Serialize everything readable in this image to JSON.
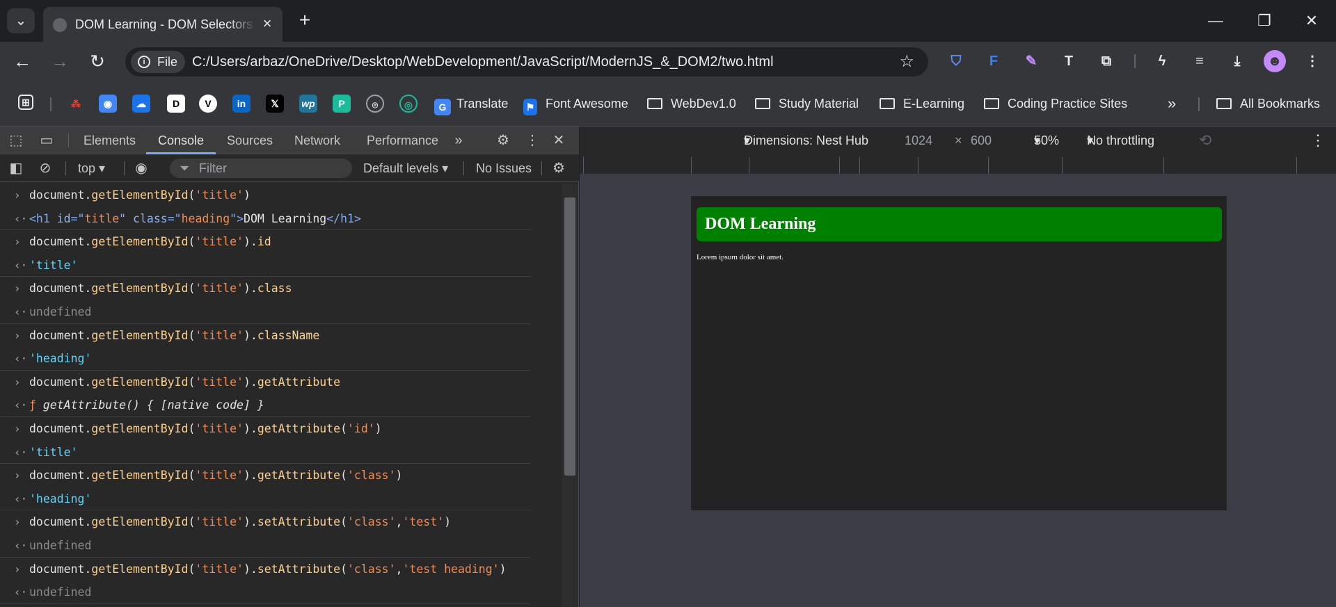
{
  "browser": {
    "tab": {
      "title": "DOM Learning - DOM Selectors"
    },
    "address": {
      "chip_label": "File",
      "url": "C:/Users/arbaz/OneDrive/Desktop/WebDevelopment/JavaScript/ModernJS_&_DOM2/two.html"
    },
    "bookmarks": [
      {
        "label": "Translate",
        "type": "link"
      },
      {
        "label": "Font Awesome",
        "type": "link"
      },
      {
        "label": "WebDev1.0",
        "type": "folder"
      },
      {
        "label": "Study Material",
        "type": "folder"
      },
      {
        "label": "E-Learning",
        "type": "folder"
      },
      {
        "label": "Coding Practice Sites",
        "type": "folder"
      }
    ],
    "all_bookmarks": "All Bookmarks",
    "more": "»"
  },
  "devtools": {
    "tabs": [
      "Elements",
      "Console",
      "Sources",
      "Network",
      "Performance"
    ],
    "active_tab": "Console",
    "context": "top",
    "filter_placeholder": "Filter",
    "levels": "Default levels",
    "issues": "No Issues"
  },
  "console": [
    {
      "dir": "in",
      "parts": [
        [
          "document.",
          ""
        ],
        [
          "getElementById",
          "m"
        ],
        [
          "(",
          ""
        ],
        [
          "'title'",
          "s"
        ],
        [
          ")",
          ""
        ]
      ]
    },
    {
      "dir": "out",
      "parts": [
        [
          "  <h1 ",
          "tag"
        ],
        [
          "id",
          "attr"
        ],
        [
          "=\"",
          "tag"
        ],
        [
          "title",
          "s"
        ],
        [
          "\" ",
          "tag"
        ],
        [
          "class",
          "attr"
        ],
        [
          "=\"",
          "tag"
        ],
        [
          "heading",
          "s"
        ],
        [
          "\">",
          "tag"
        ],
        [
          "DOM Learning",
          ""
        ],
        [
          "</h1>",
          "tag"
        ]
      ]
    },
    {
      "dir": "in",
      "parts": [
        [
          "document.",
          ""
        ],
        [
          "getElementById",
          "m"
        ],
        [
          "(",
          ""
        ],
        [
          "'title'",
          "s"
        ],
        [
          ").",
          ""
        ],
        [
          "id",
          "m"
        ]
      ]
    },
    {
      "dir": "out",
      "parts": [
        [
          "'title'",
          "str"
        ]
      ]
    },
    {
      "dir": "in",
      "parts": [
        [
          "document.",
          ""
        ],
        [
          "getElementById",
          "m"
        ],
        [
          "(",
          ""
        ],
        [
          "'title'",
          "s"
        ],
        [
          ").",
          ""
        ],
        [
          "class",
          "m"
        ]
      ]
    },
    {
      "dir": "out",
      "parts": [
        [
          "undefined",
          "und"
        ]
      ]
    },
    {
      "dir": "in",
      "parts": [
        [
          "document.",
          ""
        ],
        [
          "getElementById",
          "m"
        ],
        [
          "(",
          ""
        ],
        [
          "'title'",
          "s"
        ],
        [
          ").",
          ""
        ],
        [
          "className",
          "m"
        ]
      ]
    },
    {
      "dir": "out",
      "parts": [
        [
          "'heading'",
          "str"
        ]
      ]
    },
    {
      "dir": "in",
      "parts": [
        [
          "document.",
          ""
        ],
        [
          "getElementById",
          "m"
        ],
        [
          "(",
          ""
        ],
        [
          "'title'",
          "s"
        ],
        [
          ").",
          ""
        ],
        [
          "getAttribute",
          "m"
        ]
      ]
    },
    {
      "dir": "out",
      "parts": [
        [
          "ƒ ",
          "s"
        ],
        [
          "getAttribute() { [native code] }",
          "it"
        ]
      ]
    },
    {
      "dir": "in",
      "parts": [
        [
          "document.",
          ""
        ],
        [
          "getElementById",
          "m"
        ],
        [
          "(",
          ""
        ],
        [
          "'title'",
          "s"
        ],
        [
          ").",
          ""
        ],
        [
          "getAttribute",
          "m"
        ],
        [
          "(",
          ""
        ],
        [
          "'id'",
          "s"
        ],
        [
          ")",
          ""
        ]
      ]
    },
    {
      "dir": "out",
      "parts": [
        [
          "'title'",
          "str"
        ]
      ]
    },
    {
      "dir": "in",
      "parts": [
        [
          "document.",
          ""
        ],
        [
          "getElementById",
          "m"
        ],
        [
          "(",
          ""
        ],
        [
          "'title'",
          "s"
        ],
        [
          ").",
          ""
        ],
        [
          "getAttribute",
          "m"
        ],
        [
          "(",
          ""
        ],
        [
          "'class'",
          "s"
        ],
        [
          ")",
          ""
        ]
      ]
    },
    {
      "dir": "out",
      "parts": [
        [
          "'heading'",
          "str"
        ]
      ]
    },
    {
      "dir": "in",
      "parts": [
        [
          "document.",
          ""
        ],
        [
          "getElementById",
          "m"
        ],
        [
          "(",
          ""
        ],
        [
          "'title'",
          "s"
        ],
        [
          ").",
          ""
        ],
        [
          "setAttribute",
          "m"
        ],
        [
          "(",
          ""
        ],
        [
          "'class'",
          "s"
        ],
        [
          ",",
          ""
        ],
        [
          "'test'",
          "s"
        ],
        [
          ")",
          ""
        ]
      ]
    },
    {
      "dir": "out",
      "parts": [
        [
          "undefined",
          "und"
        ]
      ]
    },
    {
      "dir": "in",
      "parts": [
        [
          "document.",
          ""
        ],
        [
          "getElementById",
          "m"
        ],
        [
          "(",
          ""
        ],
        [
          "'title'",
          "s"
        ],
        [
          ").",
          ""
        ],
        [
          "setAttribute",
          "m"
        ],
        [
          "(",
          ""
        ],
        [
          "'class'",
          "s"
        ],
        [
          ",",
          ""
        ],
        [
          "'test heading'",
          "s"
        ],
        [
          ")",
          ""
        ]
      ]
    },
    {
      "dir": "out",
      "parts": [
        [
          "undefined",
          "und"
        ]
      ]
    }
  ],
  "device": {
    "dimensions": "Dimensions: Nest Hub",
    "width": "1024",
    "times": "×",
    "height": "600",
    "zoom": "50%",
    "throttling": "No throttling"
  },
  "page": {
    "heading": "DOM Learning",
    "paragraph": "Lorem ipsum dolor sit amet."
  },
  "colors": {
    "heading_bg": "#008000",
    "accent": "#7cacf8"
  }
}
